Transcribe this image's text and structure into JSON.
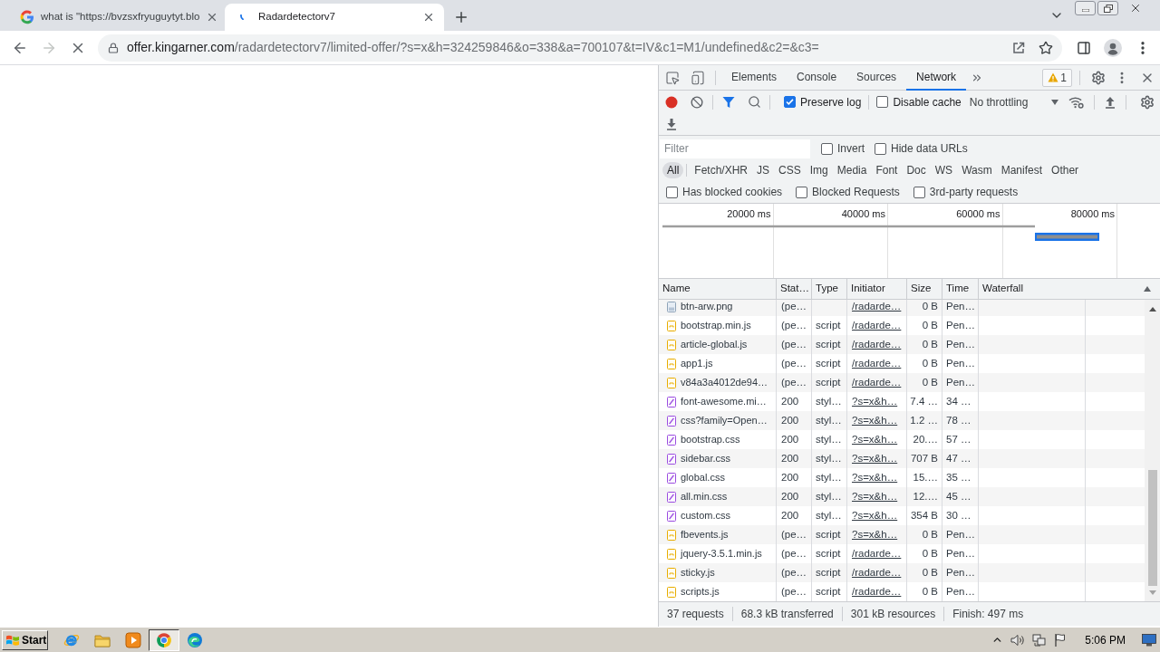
{
  "browser": {
    "tabs": [
      {
        "title": "what is \"https://bvzsxfryuguytyt.blo",
        "selected": false,
        "loading": false
      },
      {
        "title": "Radardetectorv7",
        "selected": true,
        "loading": true
      }
    ],
    "nav": {
      "forward_enabled": false,
      "loading": true
    },
    "address": {
      "host": "offer.kingarner.com",
      "path": "/radardetectorv7/limited-offer/?s=x&h=324259846&o=338&a=700107&t=IV&c1=M1/undefined&c2=&c3="
    }
  },
  "devtools": {
    "tabs": [
      {
        "label": "Elements",
        "selected": false
      },
      {
        "label": "Console",
        "selected": false
      },
      {
        "label": "Sources",
        "selected": false
      },
      {
        "label": "Network",
        "selected": true
      }
    ],
    "warnings": {
      "count": "1"
    },
    "toolbar": {
      "recording": true,
      "preserve_log": {
        "label": "Preserve log",
        "checked": true
      },
      "disable_cache": {
        "label": "Disable cache",
        "checked": false
      },
      "throttling": "No throttling"
    },
    "filter": {
      "placeholder": "Filter",
      "options": [
        {
          "label": "Invert",
          "checked": false
        },
        {
          "label": "Hide data URLs",
          "checked": false
        }
      ]
    },
    "type_filters": [
      {
        "label": "All",
        "selected": true
      },
      {
        "label": "Fetch/XHR",
        "selected": false
      },
      {
        "label": "JS",
        "selected": false
      },
      {
        "label": "CSS",
        "selected": false
      },
      {
        "label": "Img",
        "selected": false
      },
      {
        "label": "Media",
        "selected": false
      },
      {
        "label": "Font",
        "selected": false
      },
      {
        "label": "Doc",
        "selected": false
      },
      {
        "label": "WS",
        "selected": false
      },
      {
        "label": "Wasm",
        "selected": false
      },
      {
        "label": "Manifest",
        "selected": false
      },
      {
        "label": "Other",
        "selected": false
      }
    ],
    "extra_filters": [
      {
        "label": "Has blocked cookies",
        "checked": false
      },
      {
        "label": "Blocked Requests",
        "checked": false
      },
      {
        "label": "3rd-party requests",
        "checked": false
      }
    ],
    "overview": {
      "ticks": [
        "20000 ms",
        "40000 ms",
        "60000 ms",
        "80000 ms"
      ]
    },
    "table": {
      "columns": [
        "Name",
        "Stat…",
        "Type",
        "Initiator",
        "Size",
        "Time",
        "Waterfall"
      ],
      "rows": [
        {
          "kind": "image",
          "name": "btn-arw.png",
          "status": "(pe…",
          "initiator": "/radarde…",
          "size": "0 B",
          "time": "Pen…"
        },
        {
          "kind": "script",
          "name": "bootstrap.min.js",
          "status": "(pe…",
          "type": "script",
          "initiator": "/radarde…",
          "size": "0 B",
          "time": "Pen…"
        },
        {
          "kind": "script",
          "name": "article-global.js",
          "status": "(pe…",
          "type": "script",
          "initiator": "/radarde…",
          "size": "0 B",
          "time": "Pen…"
        },
        {
          "kind": "script",
          "name": "app1.js",
          "status": "(pe…",
          "type": "script",
          "initiator": "/radarde…",
          "size": "0 B",
          "time": "Pen…"
        },
        {
          "kind": "script",
          "name": "v84a3a4012de94…",
          "status": "(pe…",
          "type": "script",
          "initiator": "/radarde…",
          "size": "0 B",
          "time": "Pen…"
        },
        {
          "kind": "stylesheet",
          "name": "font-awesome.mi…",
          "status": "200",
          "type": "styl…",
          "initiator": "?s=x&h…",
          "size": "7.4 …",
          "time": "34 …"
        },
        {
          "kind": "stylesheet",
          "name": "css?family=Open…",
          "status": "200",
          "type": "styl…",
          "initiator": "?s=x&h…",
          "size": "1.2 …",
          "time": "78 …"
        },
        {
          "kind": "stylesheet",
          "name": "bootstrap.css",
          "status": "200",
          "type": "styl…",
          "initiator": "?s=x&h…",
          "size": "20.…",
          "time": "57 …"
        },
        {
          "kind": "stylesheet",
          "name": "sidebar.css",
          "status": "200",
          "type": "styl…",
          "initiator": "?s=x&h…",
          "size": "707 B",
          "time": "47 …"
        },
        {
          "kind": "stylesheet",
          "name": "global.css",
          "status": "200",
          "type": "styl…",
          "initiator": "?s=x&h…",
          "size": "15.…",
          "time": "35 …"
        },
        {
          "kind": "stylesheet",
          "name": "all.min.css",
          "status": "200",
          "type": "styl…",
          "initiator": "?s=x&h…",
          "size": "12.…",
          "time": "45 …"
        },
        {
          "kind": "stylesheet",
          "name": "custom.css",
          "status": "200",
          "type": "styl…",
          "initiator": "?s=x&h…",
          "size": "354 B",
          "time": "30 …"
        },
        {
          "kind": "script",
          "name": "fbevents.js",
          "status": "(pe…",
          "type": "script",
          "initiator": "?s=x&h…",
          "size": "0 B",
          "time": "Pen…"
        },
        {
          "kind": "script",
          "name": "jquery-3.5.1.min.js",
          "status": "(pe…",
          "type": "script",
          "initiator": "/radarde…",
          "size": "0 B",
          "time": "Pen…"
        },
        {
          "kind": "script",
          "name": "sticky.js",
          "status": "(pe…",
          "type": "script",
          "initiator": "/radarde…",
          "size": "0 B",
          "time": "Pen…"
        },
        {
          "kind": "script",
          "name": "scripts.js",
          "status": "(pe…",
          "type": "script",
          "initiator": "/radarde…",
          "size": "0 B",
          "time": "Pen…"
        }
      ]
    },
    "summary": [
      "37 requests",
      "68.3 kB transferred",
      "301 kB resources",
      "Finish: 497 ms"
    ]
  },
  "taskbar": {
    "start": "Start",
    "apps": [
      {
        "kind": "e-browser",
        "active": false
      },
      {
        "kind": "folder",
        "active": false
      },
      {
        "kind": "player",
        "active": false
      },
      {
        "kind": "round-browser",
        "active": true
      },
      {
        "kind": "wave-browser",
        "active": false
      }
    ],
    "clock": "5:06 PM"
  }
}
